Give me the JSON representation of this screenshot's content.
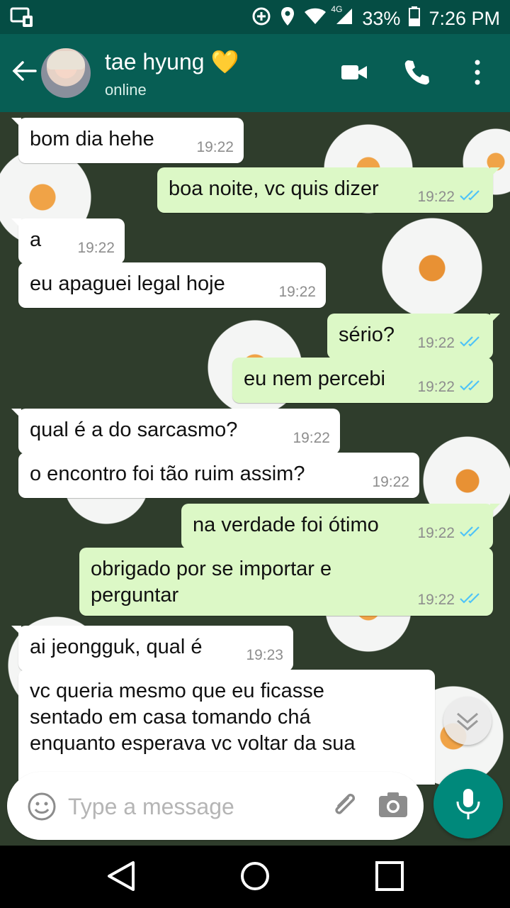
{
  "status_bar": {
    "network": "4G",
    "battery": "33%",
    "time": "7:26 PM"
  },
  "header": {
    "contact_name": "tae hyung",
    "contact_emoji": "💛",
    "status": "online",
    "icons": [
      "back-arrow-icon",
      "video-call-icon",
      "phone-icon",
      "more-vert-icon"
    ]
  },
  "messages": [
    {
      "direction": "in",
      "text": "bom dia hehe",
      "time": "19:22"
    },
    {
      "direction": "out",
      "text": "boa noite, vc quis dizer",
      "time": "19:22",
      "read": true
    },
    {
      "direction": "in",
      "text": "a",
      "time": "19:22"
    },
    {
      "direction": "in",
      "text": "eu apaguei legal hoje",
      "time": "19:22"
    },
    {
      "direction": "out",
      "text": "sério?",
      "time": "19:22",
      "read": true
    },
    {
      "direction": "out",
      "text": "eu nem percebi",
      "time": "19:22",
      "read": true
    },
    {
      "direction": "in",
      "text": "qual é a do sarcasmo?",
      "time": "19:22"
    },
    {
      "direction": "in",
      "text": "o encontro foi tão ruim assim?",
      "time": "19:22"
    },
    {
      "direction": "out",
      "text": "na verdade foi ótimo",
      "time": "19:22",
      "read": true
    },
    {
      "direction": "out",
      "text": "obrigado por se importar e\nperguntar",
      "time": "19:22",
      "read": true
    },
    {
      "direction": "in",
      "text": "ai jeongguk, qual é",
      "time": "19:23"
    },
    {
      "direction": "in",
      "text": "vc queria mesmo que eu ficasse\nsentado em casa tomando chá\nenquanto esperava vc voltar da sua",
      "time": ""
    }
  ],
  "composer": {
    "placeholder": "Type a message"
  },
  "colors": {
    "header": "#075e54",
    "status_bar": "#054d44",
    "outgoing_bubble": "#dcf8c6",
    "incoming_bubble": "#ffffff",
    "read_ticks": "#4fc3f7",
    "mic_button": "#00897b"
  }
}
